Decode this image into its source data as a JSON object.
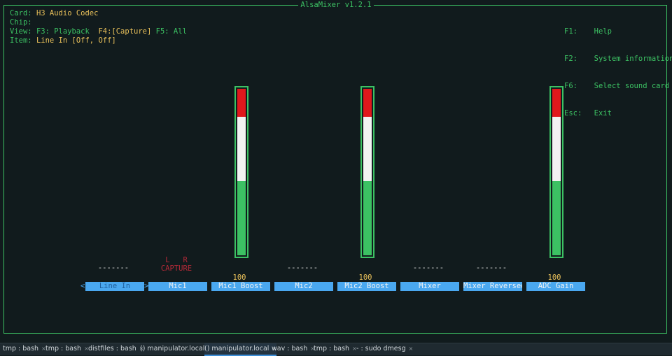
{
  "title": "AlsaMixer v1.2.1",
  "info": {
    "card_label": "Card:",
    "card_value": "H3 Audio Codec",
    "chip_label": "Chip:",
    "chip_value": "",
    "view_label": "View:",
    "view_playback": "F3: Playback",
    "view_capture": "F4:[Capture]",
    "view_all": "F5: All",
    "item_label": "Item:",
    "item_value": "Line In [Off, Off]"
  },
  "help": [
    {
      "key": "F1:",
      "text": "Help"
    },
    {
      "key": "F2:",
      "text": "System information"
    },
    {
      "key": "F6:",
      "text": "Select sound card"
    },
    {
      "key": "Esc:",
      "text": "Exit"
    }
  ],
  "controls": [
    {
      "name": "Line In",
      "selected": true,
      "dashes": "-------"
    },
    {
      "name": "Mic1",
      "lr": "L   R",
      "capture": "CAPTURE"
    },
    {
      "name": "Mic1 Boost",
      "value": "100",
      "level": 1.0
    },
    {
      "name": "Mic2",
      "dashes": "-------"
    },
    {
      "name": "Mic2 Boost",
      "value": "100",
      "level": 1.0
    },
    {
      "name": "Mixer",
      "dashes": "-------"
    },
    {
      "name": "Mixer Reversed",
      "dashes": "-------"
    },
    {
      "name": "ADC Gain",
      "value": "100",
      "level": 1.0
    }
  ],
  "arrows": {
    "left": "<",
    "right": ">"
  },
  "colors": {
    "green": "#3cc163",
    "white": "#f2f2f2",
    "red": "#e0181c"
  },
  "tabs": [
    {
      "label": "tmp : bash"
    },
    {
      "label": "tmp : bash"
    },
    {
      "label": "distfiles : bash"
    },
    {
      "label": "() manipulator.local"
    },
    {
      "label": "() manipulator.local",
      "active": true
    },
    {
      "label": "wav : bash"
    },
    {
      "label": "tmp : bash"
    },
    {
      "label": "- : sudo dmesg"
    }
  ],
  "tab_close": "×"
}
